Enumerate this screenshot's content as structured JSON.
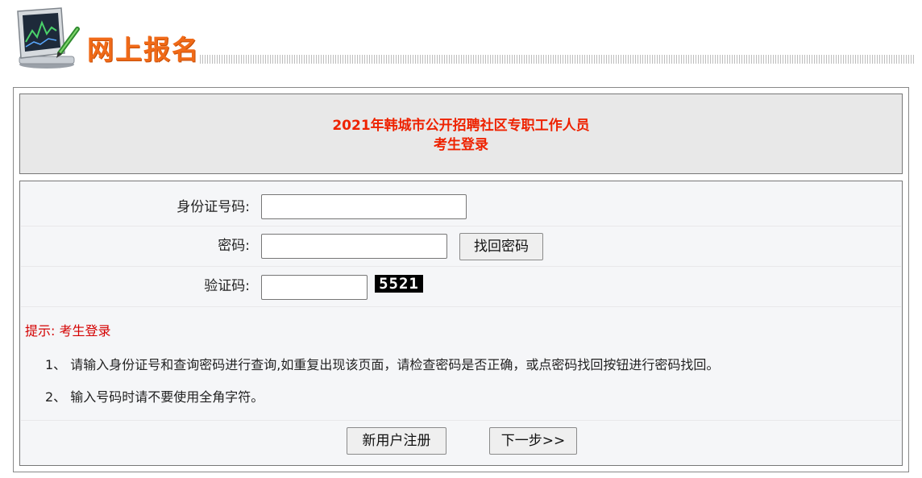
{
  "header": {
    "title": "网上报名"
  },
  "exam": {
    "title": "2021年韩城市公开招聘社区专职工作人员",
    "subtitle": "考生登录"
  },
  "form": {
    "id_label": "身份证号码:",
    "id_value": "",
    "password_label": "密码:",
    "password_value": "",
    "recover_button": "找回密码",
    "captcha_label": "验证码:",
    "captcha_value": "",
    "captcha_code": "5521"
  },
  "tips": {
    "heading": "提示:  考生登录",
    "items": [
      "1、 请输入身份证号和查询密码进行查询,如重复出现该页面，请检查密码是否正确，或点密码找回按钮进行密码找回。",
      "2、 输入号码时请不要使用全角字符。"
    ]
  },
  "actions": {
    "register_button": "新用户注册",
    "next_button": "下一步>>"
  },
  "colors": {
    "header_accent": "#f06a18",
    "title_red": "#ee2200",
    "tip_red": "#d40000",
    "panel_bg": "#e8e8e8",
    "form_bg": "#f5f6f8"
  },
  "icons": {
    "header_logo": "monitor-chart-icon"
  }
}
